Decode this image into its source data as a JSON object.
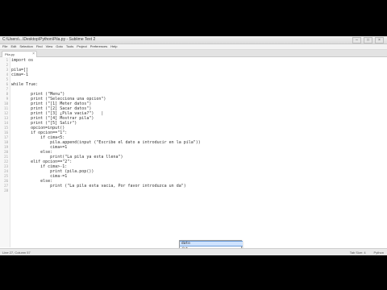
{
  "window": {
    "title": "C:\\Users\\...\\Desktop\\Python\\Pila.py - Sublime Text 2",
    "controls": [
      "–",
      "□",
      "×"
    ]
  },
  "menu": [
    "File",
    "Edit",
    "Selection",
    "Find",
    "View",
    "Goto",
    "Tools",
    "Project",
    "Preferences",
    "Help"
  ],
  "tab": {
    "label": "Pila.py",
    "close": "×"
  },
  "editor": {
    "lines": [
      "import os",
      "",
      "pila=[]",
      "cima=-1",
      "",
      "while True:",
      "",
      "        print (\"Menu\")",
      "        print (\"Selecciona una opcion\")",
      "        print (\"[1] Meter datos\")",
      "        print (\"[2] Sacar datos\")",
      "        print (\"[3] ¿Pila vacia?\")   |",
      "        print (\"[4] Mostrar pila\")",
      "        print (\"[5] Salir\")",
      "        opcion=input()",
      "        if opcion==\"1\":",
      "            if cima<5:",
      "                pila.append(input (\"Escribe el dato a introducir en la pila\"))",
      "                cima+=1",
      "            else:",
      "                print(\"La pila ya esta llena\")",
      "        elif opcion==\"2\":",
      "            if cima>-1:",
      "                print (pila.pop())",
      "                cima-=1",
      "            else:",
      "                print (\"La pila esta vacia, Por favor introduzca un da\")",
      ""
    ]
  },
  "autocomplete": {
    "items": [
      {
        "label": "dato",
        "selected": true
      },
      {
        "label": "dat",
        "selected": false
      }
    ]
  },
  "status": {
    "left": "Line 27, Column 57",
    "tab_size": "Tab Size: 4",
    "syntax": "Python"
  }
}
